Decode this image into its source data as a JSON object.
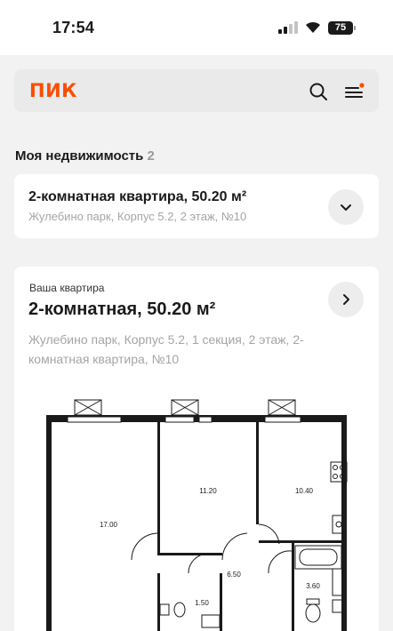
{
  "status_bar": {
    "time": "17:54",
    "battery": "75",
    "icons": [
      "signal-icon",
      "wifi-icon",
      "battery-icon"
    ]
  },
  "header": {
    "logo": "ПИК",
    "icons": [
      "search-icon",
      "menu-icon"
    ],
    "accent_color": "#fc4c02"
  },
  "properties_section": {
    "title": "Моя недвижимость",
    "count": "2"
  },
  "property_card": {
    "title": "2-комнатная квартира, 50.20 м²",
    "subtitle": "Жулебино парк, Корпус 5.2, 2 этаж, №10",
    "icon": "chevron-down-icon"
  },
  "apartment_card": {
    "label": "Ваша квартира",
    "title": "2-комнатная, 50.20 м²",
    "address": "Жулебино парк, Корпус 5.2, 1 секция, 2 этаж, 2-комнатная квартира, №10",
    "icon": "chevron-right-icon",
    "floorplan": {
      "rooms": [
        "17.00",
        "11.20",
        "10.40",
        "6.50",
        "3.60",
        "1.50"
      ]
    }
  }
}
